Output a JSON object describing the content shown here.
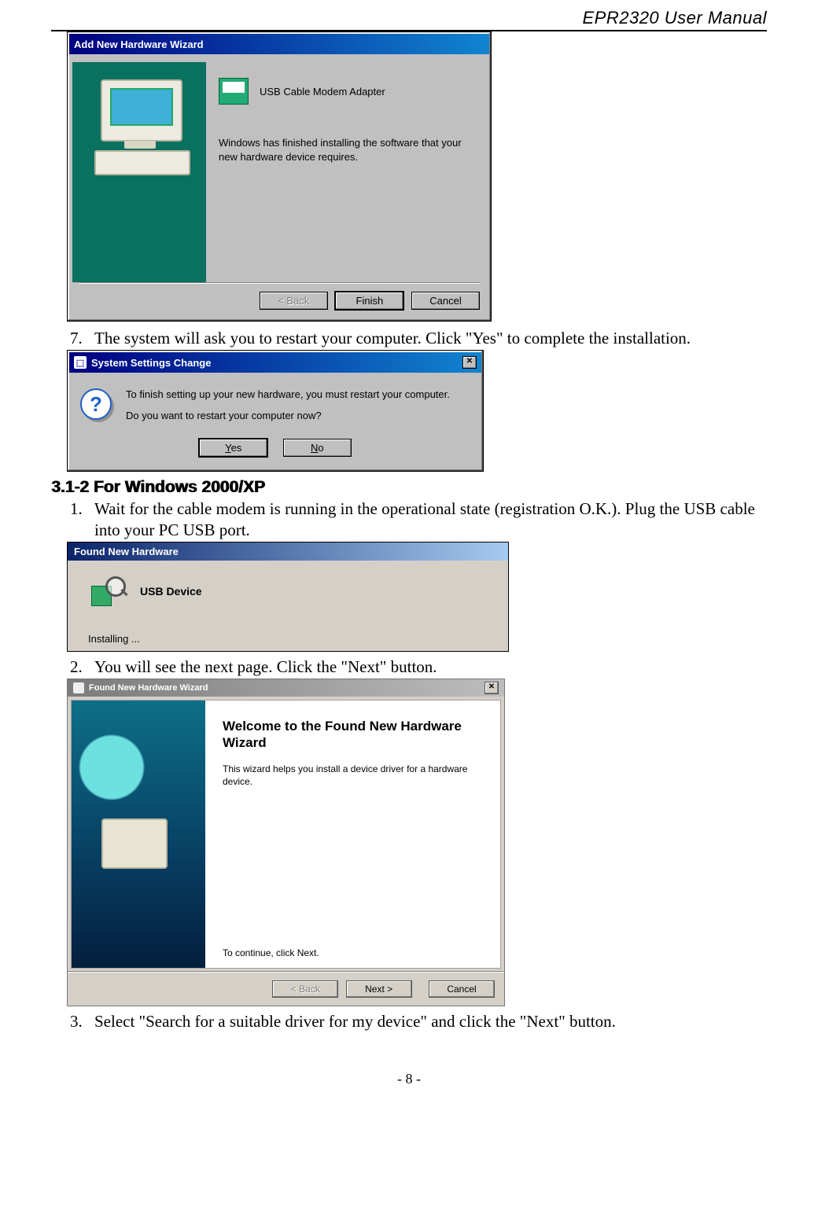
{
  "header": {
    "title": "EPR2320 User Manual"
  },
  "footer": {
    "page": "- 8 -"
  },
  "steps_a": {
    "start": 7,
    "items": [
      "The system will ask you to restart your computer. Click \"Yes\" to complete the installation."
    ]
  },
  "section_heading": "3.1-2 For Windows 2000/XP",
  "steps_b": {
    "start": 1,
    "items": [
      "Wait for the cable modem is running in the operational state (registration O.K.). Plug the USB cable into your PC USB port.",
      "You will see the next page. Click the \"Next\" button.",
      "Select \"Search for a suitable driver for my device\" and click the \"Next\" button."
    ]
  },
  "dialog1": {
    "title": "Add New Hardware Wizard",
    "device": "USB Cable Modem Adapter",
    "message": "Windows has finished installing the software that your new hardware device requires.",
    "buttons": {
      "back": "< Back",
      "finish": "Finish",
      "cancel": "Cancel"
    }
  },
  "dialog2": {
    "title": "System Settings Change",
    "icon_label": "?",
    "line1": "To finish setting up your new hardware, you must restart your computer.",
    "line2": "Do you want to restart your computer now?",
    "buttons": {
      "yes_u": "Y",
      "yes_rest": "es",
      "no_u": "N",
      "no_rest": "o"
    }
  },
  "balloon": {
    "title": "Found New Hardware",
    "device": "USB Device",
    "status": "Installing ..."
  },
  "wizard": {
    "title": "Found New Hardware Wizard",
    "heading": "Welcome to the Found New Hardware Wizard",
    "desc": "This wizard helps you install a device driver for a hardware device.",
    "continue": "To continue, click Next.",
    "buttons": {
      "back": "< Back",
      "next": "Next >",
      "cancel": "Cancel"
    }
  }
}
